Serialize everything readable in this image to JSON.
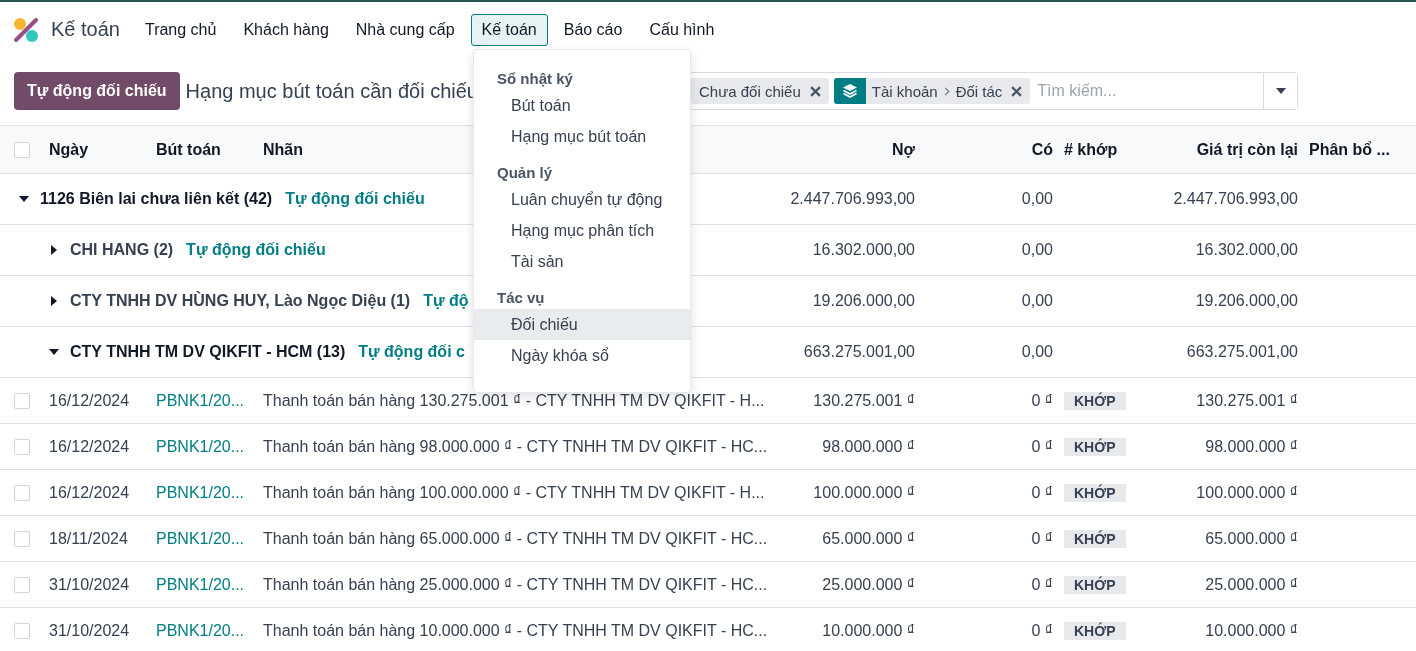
{
  "app": {
    "name": "Kế toán"
  },
  "nav": [
    {
      "label": "Trang chủ",
      "selected": false
    },
    {
      "label": "Khách hàng",
      "selected": false
    },
    {
      "label": "Nhà cung cấp",
      "selected": false
    },
    {
      "label": "Kế toán",
      "selected": true
    },
    {
      "label": "Báo cáo",
      "selected": false
    },
    {
      "label": "Cấu hình",
      "selected": false
    }
  ],
  "menu": {
    "sections": [
      {
        "header": "Sổ nhật ký",
        "items": [
          {
            "label": "Bút toán",
            "selected": false
          },
          {
            "label": "Hạng mục bút toán",
            "selected": false
          }
        ]
      },
      {
        "header": "Quản lý",
        "items": [
          {
            "label": "Luân chuyển tự động",
            "selected": false
          },
          {
            "label": "Hạng mục phân tích",
            "selected": false
          },
          {
            "label": "Tài sản",
            "selected": false
          }
        ]
      },
      {
        "header": "Tác vụ",
        "items": [
          {
            "label": "Đối chiếu",
            "selected": true
          },
          {
            "label": "Ngày khóa sổ",
            "selected": false
          }
        ]
      }
    ]
  },
  "control_panel": {
    "button": "Tự động đối chiếu",
    "title": "Hạng mục bút toán cần đối chiếu",
    "facets": [
      {
        "kind": "filter",
        "label": "Chưa đối chiếu"
      },
      {
        "kind": "group",
        "label": "Tài khoản",
        "sub": "Đối tác"
      }
    ],
    "search": {
      "placeholder": "Tìm kiếm..."
    }
  },
  "table": {
    "select_all": {
      "checked": false
    },
    "columns": [
      "Ngày",
      "Bút toán",
      "Nhãn",
      "Nợ",
      "Có",
      "# khớp",
      "Giá trị còn lại",
      "Phân bổ ..."
    ],
    "rows": [
      {
        "kind": "group",
        "label": "1126 Biên lai chưa liên kết (42)",
        "link": "Tự động đối chiếu",
        "debit": "2.447.706.993,00",
        "credit": "0,00",
        "residual": "2.447.706.993,00",
        "expanded": true,
        "children": [
          {
            "kind": "group",
            "label": "CHI HANG (2)",
            "link": "Tự động đối chiếu",
            "debit": "16.302.000,00",
            "credit": "0,00",
            "residual": "16.302.000,00",
            "expanded": false
          },
          {
            "kind": "group",
            "label": "CTY TNHH DV HÙNG HUY, Lào Ngọc Diệu (1)",
            "link": "Tự độ",
            "debit": "19.206.000,00",
            "credit": "0,00",
            "residual": "19.206.000,00",
            "expanded": false
          },
          {
            "kind": "group",
            "label": "CTY TNHH TM DV QIKFIT - HCM (13)",
            "link": "Tự động đối c",
            "debit": "663.275.001,00",
            "credit": "0,00",
            "residual": "663.275.001,00",
            "expanded": true,
            "children": [
              {
                "kind": "record",
                "checked": false,
                "date": "16/12/2024",
                "ref": "PBNK1/20...",
                "label": "Thanh toán bán hàng 130.275.001 ₫ - CTY TNHH TM DV QIKFIT - H...",
                "debit": "130.275.001 ₫",
                "credit": "0 ₫",
                "match": "KHỚP",
                "residual": "130.275.001 ₫"
              },
              {
                "kind": "record",
                "checked": false,
                "date": "16/12/2024",
                "ref": "PBNK1/20...",
                "label": "Thanh toán bán hàng 98.000.000 ₫ - CTY TNHH TM DV QIKFIT - HC...",
                "debit": "98.000.000 ₫",
                "credit": "0 ₫",
                "match": "KHỚP",
                "residual": "98.000.000 ₫"
              },
              {
                "kind": "record",
                "checked": false,
                "date": "16/12/2024",
                "ref": "PBNK1/20...",
                "label": "Thanh toán bán hàng 100.000.000 ₫ - CTY TNHH TM DV QIKFIT - H...",
                "debit": "100.000.000 ₫",
                "credit": "0 ₫",
                "match": "KHỚP",
                "residual": "100.000.000 ₫"
              },
              {
                "kind": "record",
                "checked": false,
                "date": "18/11/2024",
                "ref": "PBNK1/20...",
                "label": "Thanh toán bán hàng 65.000.000 ₫ - CTY TNHH TM DV QIKFIT - HC...",
                "debit": "65.000.000 ₫",
                "credit": "0 ₫",
                "match": "KHỚP",
                "residual": "65.000.000 ₫"
              },
              {
                "kind": "record",
                "checked": false,
                "date": "31/10/2024",
                "ref": "PBNK1/20...",
                "label": "Thanh toán bán hàng 25.000.000 ₫ - CTY TNHH TM DV QIKFIT - HC...",
                "debit": "25.000.000 ₫",
                "credit": "0 ₫",
                "match": "KHỚP",
                "residual": "25.000.000 ₫"
              },
              {
                "kind": "record",
                "checked": false,
                "date": "31/10/2024",
                "ref": "PBNK1/20...",
                "label": "Thanh toán bán hàng 10.000.000 ₫ - CTY TNHH TM DV QIKFIT - HC...",
                "debit": "10.000.000 ₫",
                "credit": "0 ₫",
                "match": "KHỚP",
                "residual": "10.000.000 ₫"
              }
            ]
          }
        ]
      }
    ]
  }
}
